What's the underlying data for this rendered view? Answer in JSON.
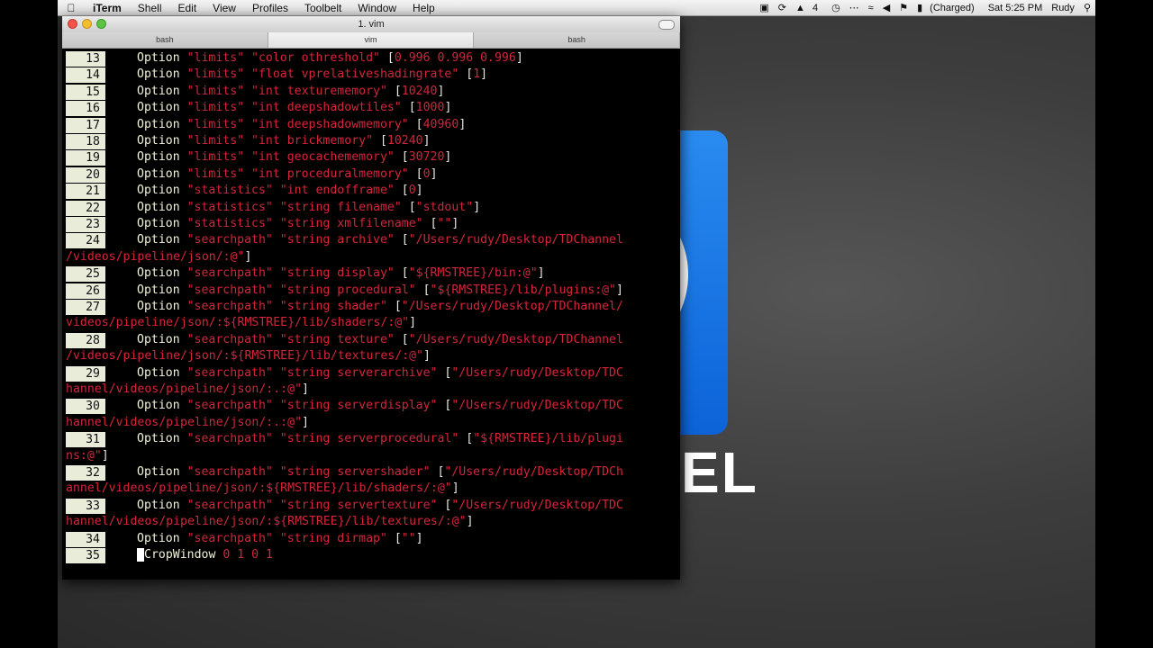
{
  "menubar": {
    "items": [
      "iTerm",
      "Shell",
      "Edit",
      "View",
      "Profiles",
      "Toolbelt",
      "Window",
      "Help"
    ],
    "status": {
      "adobe": "4",
      "battery": "(Charged)",
      "clock": "Sat 5:25 PM",
      "user": "Rudy"
    }
  },
  "window": {
    "title": "1. vim",
    "tabs": [
      "bash",
      "vim",
      "bash"
    ]
  },
  "vim": {
    "lines": [
      {
        "n": "13",
        "parts": [
          "Option ",
          "\"limits\" \"color othreshold\" ",
          "[",
          "0.996 0.996 0.996",
          "]"
        ]
      },
      {
        "n": "14",
        "parts": [
          "Option ",
          "\"limits\" \"float vprelativeshadingrate\" ",
          "[",
          "1",
          "]"
        ]
      },
      {
        "n": "15",
        "parts": [
          "Option ",
          "\"limits\" \"int texturememory\" ",
          "[",
          "10240",
          "]"
        ]
      },
      {
        "n": "16",
        "parts": [
          "Option ",
          "\"limits\" \"int deepshadowtiles\" ",
          "[",
          "1000",
          "]"
        ]
      },
      {
        "n": "17",
        "parts": [
          "Option ",
          "\"limits\" \"int deepshadowmemory\" ",
          "[",
          "40960",
          "]"
        ]
      },
      {
        "n": "18",
        "parts": [
          "Option ",
          "\"limits\" \"int brickmemory\" ",
          "[",
          "10240",
          "]"
        ]
      },
      {
        "n": "19",
        "parts": [
          "Option ",
          "\"limits\" \"int geocachememory\" ",
          "[",
          "30720",
          "]"
        ]
      },
      {
        "n": "20",
        "parts": [
          "Option ",
          "\"limits\" \"int proceduralmemory\" ",
          "[",
          "0",
          "]"
        ]
      },
      {
        "n": "21",
        "parts": [
          "Option ",
          "\"statistics\" \"int endofframe\" ",
          "[",
          "0",
          "]"
        ]
      },
      {
        "n": "22",
        "parts": [
          "Option ",
          "\"statistics\" \"string filename\" ",
          "[",
          "\"stdout\"",
          "]"
        ]
      },
      {
        "n": "23",
        "parts": [
          "Option ",
          "\"statistics\" \"string xmlfilename\" ",
          "[",
          "\"\"",
          "]"
        ]
      },
      {
        "n": "24",
        "parts": [
          "Option ",
          "\"searchpath\" \"string archive\" ",
          "[",
          "\"/Users/rudy/Desktop/TDChannel",
          ""
        ]
      },
      {
        "n": "",
        "parts": [
          "",
          "/videos/pipeline/json/:@\"",
          "]",
          "",
          ""
        ]
      },
      {
        "n": "25",
        "parts": [
          "Option ",
          "\"searchpath\" \"string display\" ",
          "[",
          "\"${RMSTREE}/bin:@\"",
          "]"
        ]
      },
      {
        "n": "26",
        "parts": [
          "Option ",
          "\"searchpath\" \"string procedural\" ",
          "[",
          "\"${RMSTREE}/lib/plugins:@\"",
          "]"
        ]
      },
      {
        "n": "27",
        "parts": [
          "Option ",
          "\"searchpath\" \"string shader\" ",
          "[",
          "\"/Users/rudy/Desktop/TDChannel/",
          ""
        ]
      },
      {
        "n": "",
        "parts": [
          "",
          "videos/pipeline/json/:${RMSTREE}/lib/shaders/:@\"",
          "]",
          "",
          ""
        ]
      },
      {
        "n": "28",
        "parts": [
          "Option ",
          "\"searchpath\" \"string texture\" ",
          "[",
          "\"/Users/rudy/Desktop/TDChannel",
          ""
        ]
      },
      {
        "n": "",
        "parts": [
          "",
          "/videos/pipeline/json/:${RMSTREE}/lib/textures/:@\"",
          "]",
          "",
          ""
        ]
      },
      {
        "n": "29",
        "parts": [
          "Option ",
          "\"searchpath\" \"string serverarchive\" ",
          "[",
          "\"/Users/rudy/Desktop/TDC",
          ""
        ]
      },
      {
        "n": "",
        "parts": [
          "",
          "hannel/videos/pipeline/json/:.:@\"",
          "]",
          "",
          ""
        ]
      },
      {
        "n": "30",
        "parts": [
          "Option ",
          "\"searchpath\" \"string serverdisplay\" ",
          "[",
          "\"/Users/rudy/Desktop/TDC",
          ""
        ]
      },
      {
        "n": "",
        "parts": [
          "",
          "hannel/videos/pipeline/json/:.:@\"",
          "]",
          "",
          ""
        ]
      },
      {
        "n": "31",
        "parts": [
          "Option ",
          "\"searchpath\" \"string serverprocedural\" ",
          "[",
          "\"${RMSTREE}/lib/plugi",
          ""
        ]
      },
      {
        "n": "",
        "parts": [
          "",
          "ns:@\"",
          "]",
          "",
          ""
        ]
      },
      {
        "n": "32",
        "parts": [
          "Option ",
          "\"searchpath\" \"string servershader\" ",
          "[",
          "\"/Users/rudy/Desktop/TDCh",
          ""
        ]
      },
      {
        "n": "",
        "parts": [
          "",
          "annel/videos/pipeline/json/:${RMSTREE}/lib/shaders/:@\"",
          "]",
          "",
          ""
        ]
      },
      {
        "n": "33",
        "parts": [
          "Option ",
          "\"searchpath\" \"string servertexture\" ",
          "[",
          "\"/Users/rudy/Desktop/TDC",
          ""
        ]
      },
      {
        "n": "",
        "parts": [
          "",
          "hannel/videos/pipeline/json/:${RMSTREE}/lib/textures/:@\"",
          "]",
          "",
          ""
        ]
      },
      {
        "n": "34",
        "parts": [
          "Option ",
          "\"searchpath\" \"string dirmap\" ",
          "[",
          "\"\"",
          "]"
        ]
      },
      {
        "n": "35",
        "parts": [
          "CropWindow ",
          "0 1 0 1",
          "",
          "",
          ""
        ]
      }
    ]
  }
}
